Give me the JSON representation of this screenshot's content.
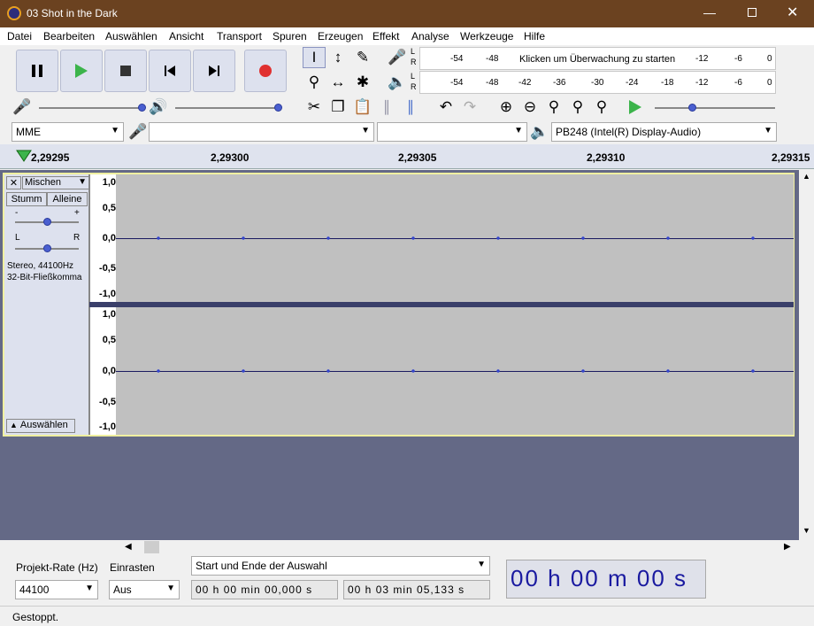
{
  "window": {
    "title": "03 Shot in the Dark"
  },
  "menu": [
    "Datei",
    "Bearbeiten",
    "Auswählen",
    "Ansicht",
    "Transport",
    "Spuren",
    "Erzeugen",
    "Effekt",
    "Analyse",
    "Werkzeuge",
    "Hilfe"
  ],
  "meters": {
    "record": {
      "ticks": [
        "-54",
        "-48",
        "-12",
        "-6",
        "0"
      ],
      "hint": "Klicken um Überwachung zu starten",
      "channels": [
        "L",
        "R"
      ]
    },
    "play": {
      "ticks": [
        "-54",
        "-48",
        "-42",
        "-36",
        "-30",
        "-24",
        "-18",
        "-12",
        "-6",
        "0"
      ],
      "channels": [
        "L",
        "R"
      ]
    }
  },
  "devices": {
    "host": "MME",
    "rec_device": "",
    "rec_channels": "",
    "play_device": "PB248 (Intel(R) Display-Audio)"
  },
  "ruler": {
    "labels": [
      "2,29295",
      "2,29300",
      "2,29305",
      "2,29310",
      "2,29315"
    ]
  },
  "track": {
    "name": "Mischen",
    "mute": "Stumm",
    "solo": "Alleine",
    "info1": "Stereo, 44100Hz",
    "info2": "32-Bit-Fließkomma",
    "select": "Auswählen",
    "pan_l": "L",
    "pan_r": "R",
    "gain_minus": "-",
    "gain_plus": "+",
    "y_labels": [
      "1,0",
      "0,5",
      "0,0",
      "-0,5",
      "-1,0"
    ]
  },
  "selection": {
    "rate_label": "Projekt-Rate (Hz)",
    "rate_value": "44100",
    "snap_label": "Einrasten",
    "snap_value": "Aus",
    "mode": "Start und Ende der Auswahl",
    "start": "00 h 00 min 00,000 s",
    "end": "00 h 03 min 05,133 s",
    "position": "00 h 00 m 00 s"
  },
  "status": "Gestoppt."
}
